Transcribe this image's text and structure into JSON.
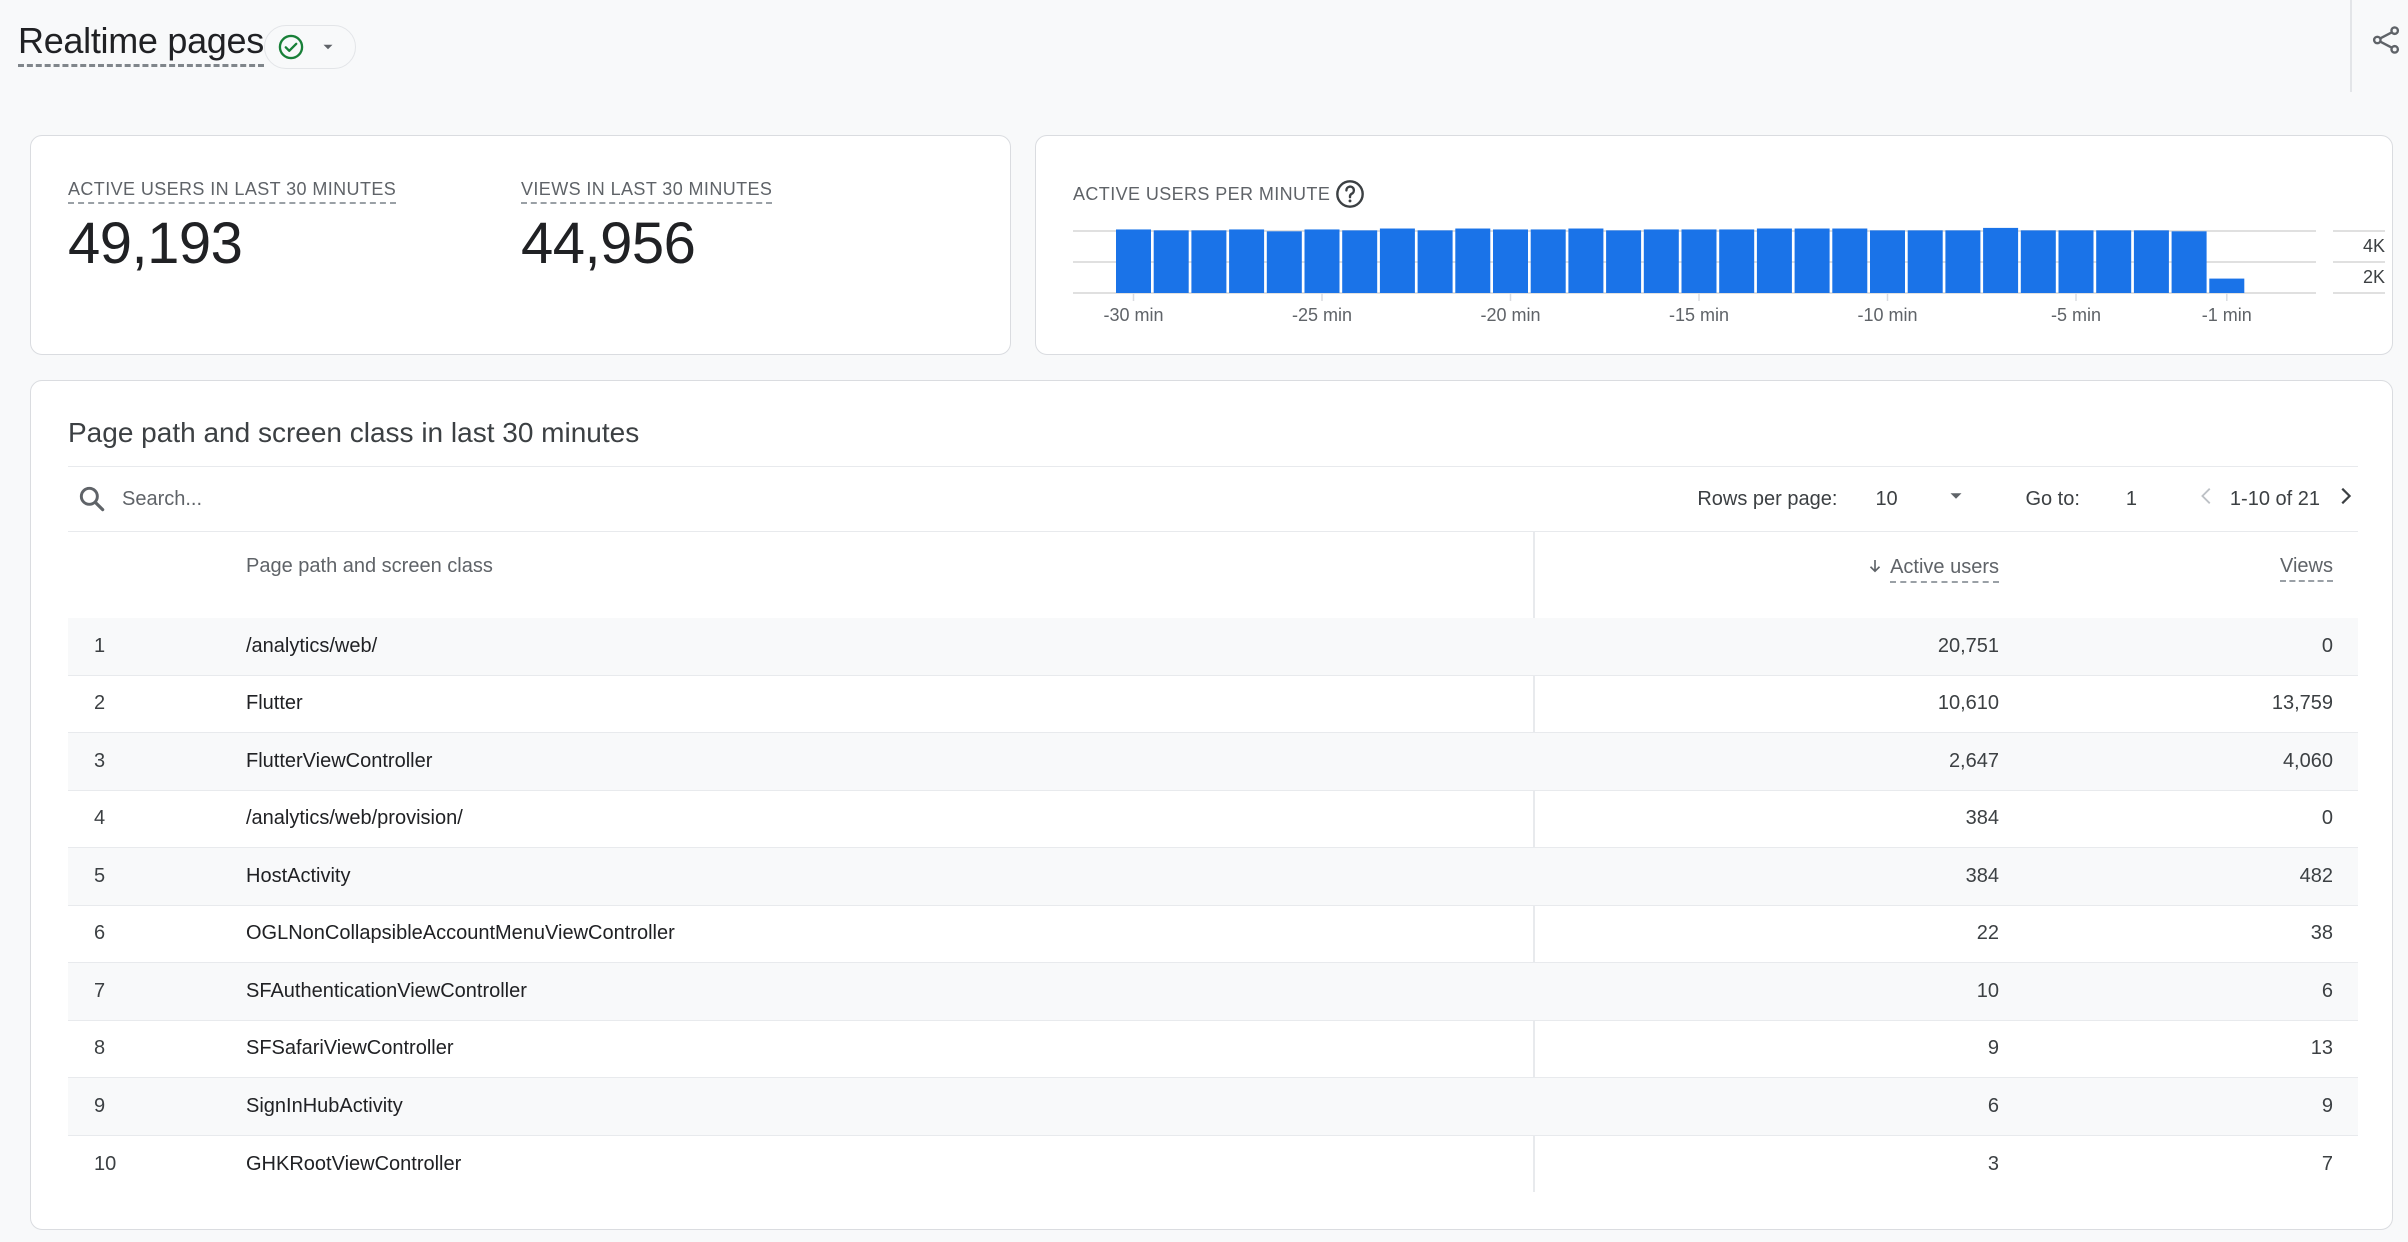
{
  "header": {
    "title": "Realtime pages",
    "status_icon": "check-circle-icon",
    "status_color": "#188038",
    "dropdown_icon": "caret-down-icon",
    "share_icon": "share-icon"
  },
  "summary": {
    "metrics": [
      {
        "label": "ACTIVE USERS IN LAST 30 MINUTES",
        "value": "49,193"
      },
      {
        "label": "VIEWS IN LAST 30 MINUTES",
        "value": "44,956"
      }
    ]
  },
  "chart_data": {
    "type": "bar",
    "title": "ACTIVE USERS PER MINUTE",
    "help_icon": "help-circle-icon",
    "bar_color": "#1a73e8",
    "xlabel": "",
    "ylabel": "",
    "ylim": [
      0,
      4000
    ],
    "y_ticks": [
      {
        "value": 4000,
        "label": "4K"
      },
      {
        "value": 2000,
        "label": "2K"
      }
    ],
    "y_axis_position": "right",
    "grid": true,
    "x_ticks": [
      {
        "minute": -30,
        "label": "-30 min"
      },
      {
        "minute": -25,
        "label": "-25 min"
      },
      {
        "minute": -20,
        "label": "-20 min"
      },
      {
        "minute": -15,
        "label": "-15 min"
      },
      {
        "minute": -10,
        "label": "-10 min"
      },
      {
        "minute": -5,
        "label": "-5 min"
      },
      {
        "minute": -1,
        "label": "-1 min"
      }
    ],
    "x": [
      -30,
      -29,
      -28,
      -27,
      -26,
      -25,
      -24,
      -23,
      -22,
      -21,
      -20,
      -19,
      -18,
      -17,
      -16,
      -15,
      -14,
      -13,
      -12,
      -11,
      -10,
      -9,
      -8,
      -7,
      -6,
      -5,
      -4,
      -3,
      -2,
      -1
    ],
    "values": [
      4100,
      4040,
      4040,
      4100,
      3980,
      4100,
      4040,
      4160,
      4040,
      4160,
      4100,
      4100,
      4160,
      4040,
      4100,
      4100,
      4100,
      4160,
      4160,
      4160,
      4040,
      4040,
      4040,
      4200,
      4040,
      4040,
      4040,
      4040,
      3980,
      930
    ]
  },
  "table": {
    "title": "Page path and screen class in last 30 minutes",
    "search": {
      "placeholder": "Search...",
      "value": ""
    },
    "pagination": {
      "rows_per_page_label": "Rows per page:",
      "rows_per_page": "10",
      "goto_label": "Go to:",
      "goto_value": "1",
      "range": "1-10 of 21"
    },
    "columns": {
      "dimension": "Page path and screen class",
      "active_users": "Active users",
      "views": "Views",
      "sort": "descending on Active users"
    },
    "rows": [
      {
        "index": "1",
        "name": "/analytics/web/",
        "active_users": "20,751",
        "views": "0"
      },
      {
        "index": "2",
        "name": "Flutter",
        "active_users": "10,610",
        "views": "13,759"
      },
      {
        "index": "3",
        "name": "FlutterViewController",
        "active_users": "2,647",
        "views": "4,060"
      },
      {
        "index": "4",
        "name": "/analytics/web/provision/",
        "active_users": "384",
        "views": "0"
      },
      {
        "index": "5",
        "name": "HostActivity",
        "active_users": "384",
        "views": "482"
      },
      {
        "index": "6",
        "name": "OGLNonCollapsibleAccountMenuViewController",
        "active_users": "22",
        "views": "38"
      },
      {
        "index": "7",
        "name": "SFAuthenticationViewController",
        "active_users": "10",
        "views": "6"
      },
      {
        "index": "8",
        "name": "SFSafariViewController",
        "active_users": "9",
        "views": "13"
      },
      {
        "index": "9",
        "name": "SignInHubActivity",
        "active_users": "6",
        "views": "9"
      },
      {
        "index": "10",
        "name": "GHKRootViewController",
        "active_users": "3",
        "views": "7"
      }
    ]
  }
}
